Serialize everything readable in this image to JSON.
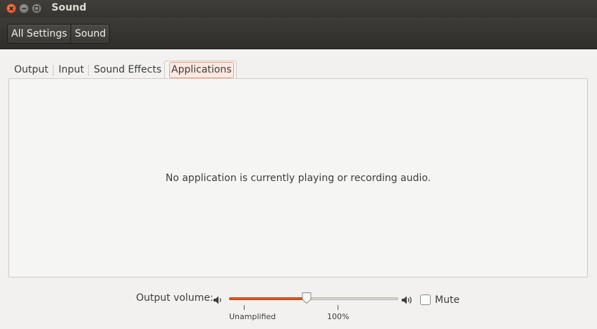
{
  "window": {
    "title": "Sound",
    "controls": [
      "close-icon",
      "minimize-icon",
      "maximize-icon"
    ]
  },
  "breadcrumb": [
    "All Settings",
    "Sound"
  ],
  "tabs": [
    {
      "label": "Output"
    },
    {
      "label": "Input"
    },
    {
      "label": "Sound Effects"
    },
    {
      "label": "Applications",
      "active": true
    }
  ],
  "applications_panel": {
    "message": "No application is currently playing or recording audio."
  },
  "volume": {
    "label": "Output volume:",
    "level_fraction": 0.46,
    "ticks": [
      "Unamplified",
      "100%"
    ],
    "low_icon": "speaker-low-icon",
    "high_icon": "speaker-high-icon",
    "mute_label": "Mute",
    "muted": false
  },
  "colors": {
    "accent": "#e0591f",
    "titlebar": "#3c3b37",
    "background": "#f2f1f0",
    "close_button": "#e95420"
  }
}
